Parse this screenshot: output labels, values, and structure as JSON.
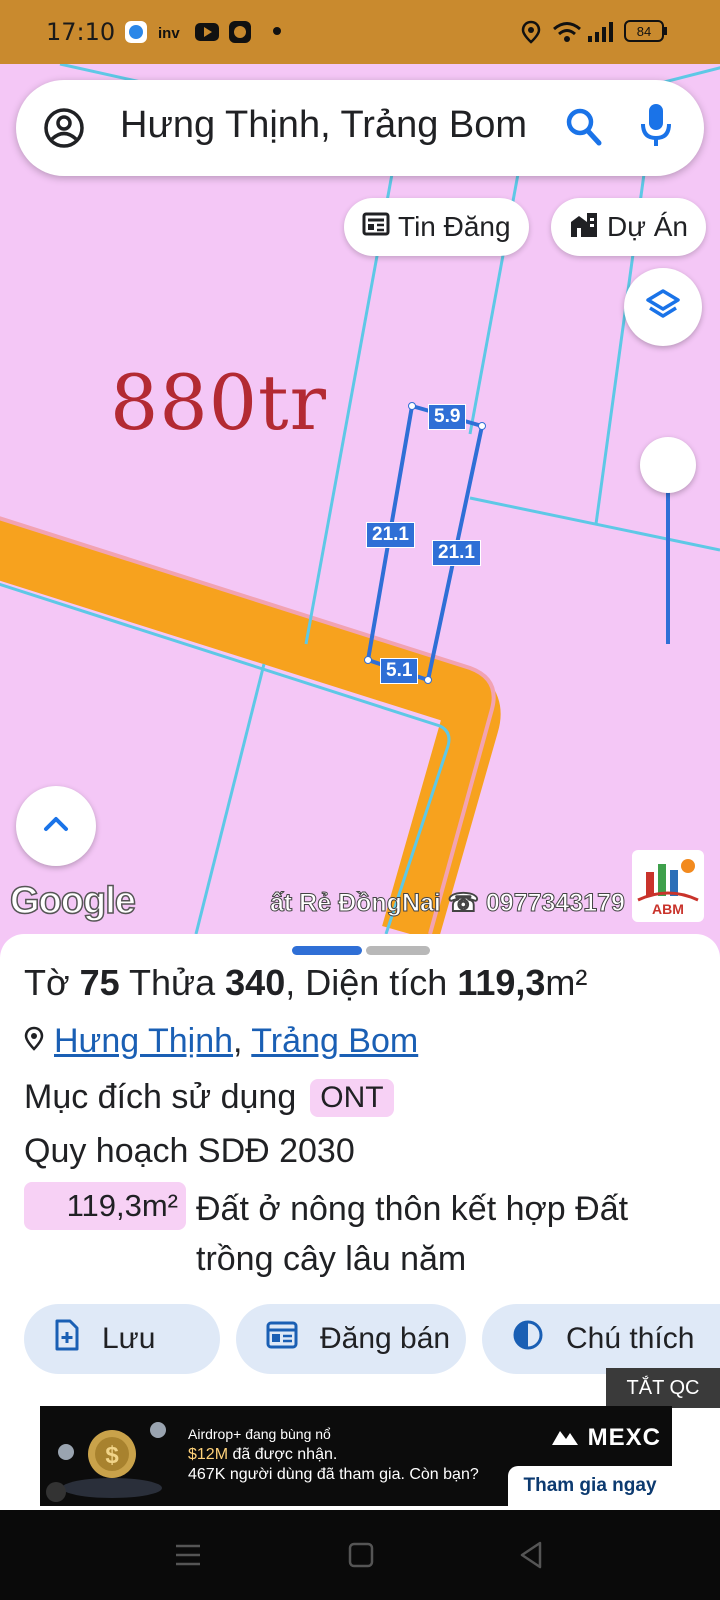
{
  "status_bar": {
    "time": "17:10",
    "battery": "84",
    "icons": [
      "app-icon",
      "inv-icon",
      "youtube-icon",
      "lion-icon",
      "dot-icon",
      "location-icon",
      "wifi-icon",
      "signal-icon",
      "battery-icon"
    ]
  },
  "search": {
    "query": "Hưng Thịnh, Trảng Bom",
    "icons": [
      "account-icon",
      "search-icon",
      "mic-icon"
    ]
  },
  "map": {
    "chips": [
      {
        "label": "Tin Đăng",
        "icon": "newspaper-icon"
      },
      {
        "label": "Dự Án",
        "icon": "building-icon"
      }
    ],
    "price_label": "880tr",
    "dimensions": {
      "top": "5.9",
      "left": "21.1",
      "right": "21.1",
      "bottom": "5.1"
    },
    "google_logo": "Google",
    "watermark": "ất Rẻ ĐồngNai ☎ 0977343179",
    "logo_text": "ABM"
  },
  "parcel": {
    "line1_prefix": "Tờ ",
    "sheet_no": "75",
    "line1_mid": " Thửa ",
    "parcel_no": "340",
    "line1_area_label": ", Diện tích ",
    "area": "119,3",
    "area_unit": "m²",
    "district": "Hưng Thịnh",
    "separator": ", ",
    "province": "Trảng Bom",
    "purpose_label": "Mục đích sử dụng",
    "purpose_code": "ONT",
    "plan_label": "Quy hoạch SDĐ 2030",
    "plan_area": "119,3m²",
    "plan_desc": "Đất ở nông thôn kết hợp Đất trồng cây lâu năm"
  },
  "actions": [
    {
      "label": "Lưu",
      "icon": "save-file-icon"
    },
    {
      "label": "Đăng bán",
      "icon": "listing-icon"
    },
    {
      "label": "Chú thích",
      "icon": "contrast-icon"
    }
  ],
  "ad_close": "TẮT QC",
  "ad": {
    "line1": "Airdrop+ đang bùng nổ",
    "amount": "$12M",
    "line2_rest": " đã được nhận.",
    "line3": "467K người dùng đã tham gia. Còn bạn?",
    "brand": "MEXC",
    "cta": "Tham gia ngay"
  },
  "colors": {
    "status_bar": "#c98a2e",
    "land_pink": "#f4c7f6",
    "road_orange": "#f7a21e",
    "parcel_blue": "#2f6fd6",
    "price_red": "#b32a33",
    "button_bg": "#dfe9f7",
    "link_blue": "#1a5fb4"
  }
}
